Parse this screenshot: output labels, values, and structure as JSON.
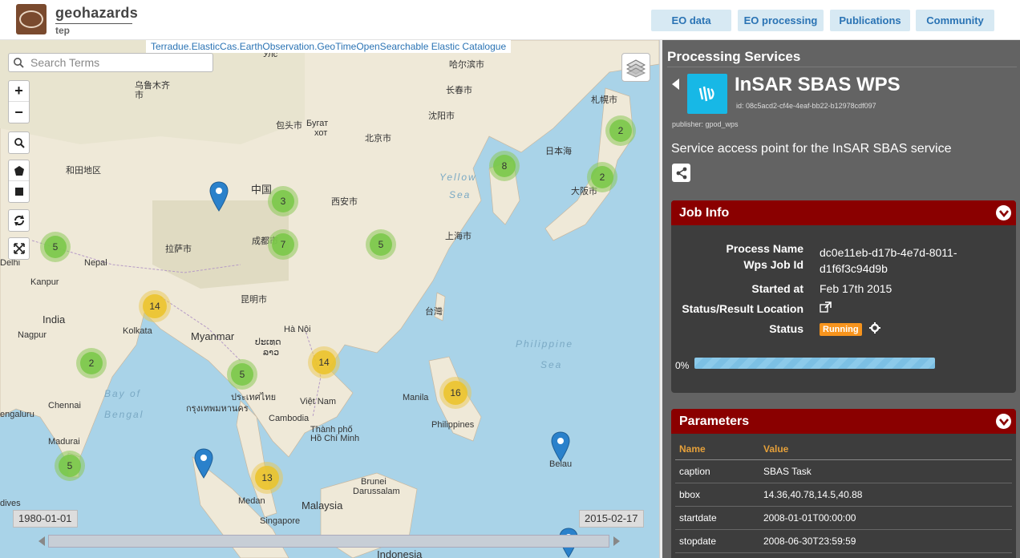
{
  "header": {
    "brand_name": "geohazards",
    "brand_sub": "tep",
    "nav": [
      "EO data",
      "EO processing",
      "Publications",
      "Community"
    ]
  },
  "map": {
    "catalog_label": "Terradue.ElasticCas.EarthObservation.GeoTimeOpenSearchable Elastic Catalogue",
    "search_placeholder": "Search Terms",
    "date_start": "1980-01-01",
    "date_end": "2015-02-17",
    "labels": [
      {
        "t": "Улс"
      },
      {
        "t": "哈尔滨市"
      },
      {
        "t": "乌鲁木齐"
      },
      {
        "t": "市"
      },
      {
        "t": "长春市"
      },
      {
        "t": "札幌市"
      },
      {
        "t": "沈阳市"
      },
      {
        "t": "包头市"
      },
      {
        "t": "Бугат"
      },
      {
        "t": "хот"
      },
      {
        "t": "北京市"
      },
      {
        "t": "和田地区"
      },
      {
        "t": "中国"
      },
      {
        "t": "西安市"
      },
      {
        "t": "Yellow"
      },
      {
        "t": "Sea"
      },
      {
        "t": "大阪市"
      },
      {
        "t": "拉萨市"
      },
      {
        "t": "成都市"
      },
      {
        "t": "上海市"
      },
      {
        "t": "Nepal"
      },
      {
        "t": "Kanpur"
      },
      {
        "t": "昆明市"
      },
      {
        "t": "台灣"
      },
      {
        "t": "India"
      },
      {
        "t": "Kolkata"
      },
      {
        "t": "Myanmar"
      },
      {
        "t": "Hà Nội"
      },
      {
        "t": "Nagpur"
      },
      {
        "t": "Philippine"
      },
      {
        "t": "Sea"
      },
      {
        "t": "Bay of"
      },
      {
        "t": "Bengal"
      },
      {
        "t": "Việt Nam"
      },
      {
        "t": "Manila"
      },
      {
        "t": "Chennai"
      },
      {
        "t": "Cambodia"
      },
      {
        "t": "Philippines"
      },
      {
        "t": "Thành phố"
      },
      {
        "t": "Hồ Chí Minh"
      },
      {
        "t": "Madurai"
      },
      {
        "t": "Belau"
      },
      {
        "t": "Brunei"
      },
      {
        "t": "Darussalam"
      },
      {
        "t": "Medan"
      },
      {
        "t": "Malaysia"
      },
      {
        "t": "Singapore"
      },
      {
        "t": "Indonesia"
      },
      {
        "t": "Delhi"
      },
      {
        "t": "engaluru"
      },
      {
        "t": "dives"
      },
      {
        "t": "日本海"
      },
      {
        "t": "ประเทศไทย"
      },
      {
        "t": "กรุงเทพมหานคร"
      },
      {
        "t": "ປະເທດ"
      },
      {
        "t": "ລາວ"
      }
    ],
    "clusters": [
      {
        "n": "2",
        "c": "green"
      },
      {
        "n": "8",
        "c": "green"
      },
      {
        "n": "2",
        "c": "green"
      },
      {
        "n": "3",
        "c": "green"
      },
      {
        "n": "7",
        "c": "green"
      },
      {
        "n": "5",
        "c": "green"
      },
      {
        "n": "5",
        "c": "green"
      },
      {
        "n": "14",
        "c": "yellow"
      },
      {
        "n": "2",
        "c": "green"
      },
      {
        "n": "14",
        "c": "yellow"
      },
      {
        "n": "5",
        "c": "green"
      },
      {
        "n": "16",
        "c": "yellow"
      },
      {
        "n": "5",
        "c": "green"
      },
      {
        "n": "13",
        "c": "yellow"
      }
    ]
  },
  "panel": {
    "title": "Processing Services",
    "service_name": "InSAR SBAS WPS",
    "service_id": "id: 08c5acd2-cf4e-4eaf-bb22-b12978cdf097",
    "publisher": "publisher: gpod_wps",
    "description": "Service access point for the InSAR SBAS service",
    "job_info": {
      "title": "Job Info",
      "process_name_key": "Process Name",
      "wps_job_id_key": "Wps Job Id",
      "job_id_line1": "dc0e11eb-d17b-4e7d-8011-",
      "job_id_line2": "d1f6f3c94d9b",
      "started_key": "Started at",
      "started_val": "Feb 17th 2015",
      "location_key": "Status/Result Location",
      "status_key": "Status",
      "status_val": "Running",
      "progress_label": "0%",
      "progress_value": 0
    },
    "parameters": {
      "title": "Parameters",
      "col_name": "Name",
      "col_value": "Value",
      "rows": [
        {
          "k": "caption",
          "v": "SBAS Task"
        },
        {
          "k": "bbox",
          "v": "14.36,40.78,14.5,40.88"
        },
        {
          "k": "startdate",
          "v": "2008-01-01T00:00:00"
        },
        {
          "k": "stopdate",
          "v": "2008-06-30T23:59:59"
        }
      ]
    },
    "colors": {
      "accent": "#8a0000",
      "status": "#f7941d",
      "service": "#17b8e6"
    }
  }
}
